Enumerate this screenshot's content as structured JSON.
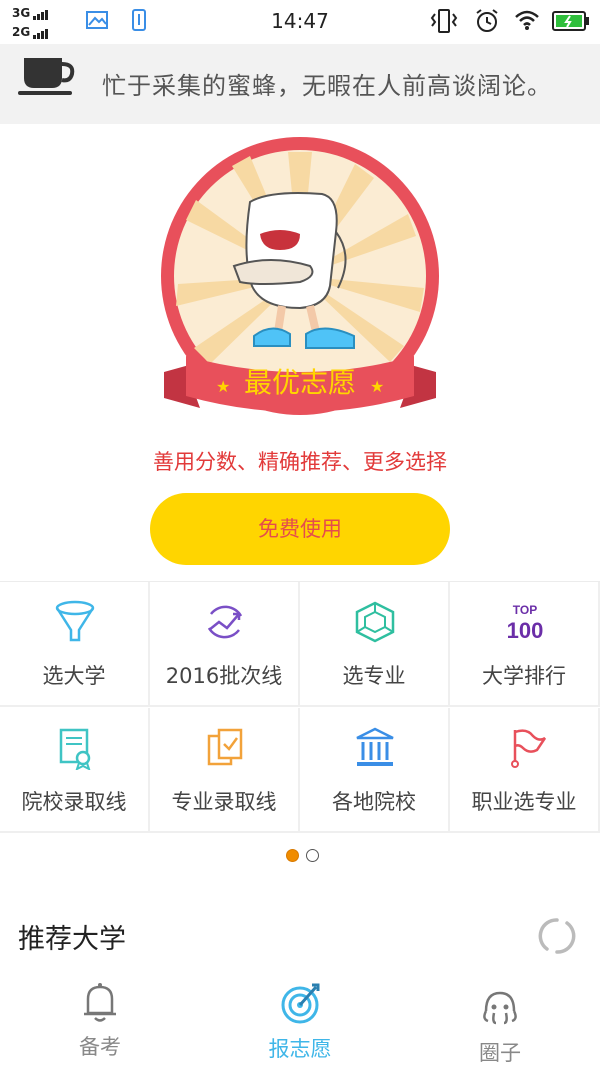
{
  "status_bar": {
    "sig1": "3G",
    "sig2": "2G",
    "time": "14:47"
  },
  "quote": {
    "text": "忙于采集的蜜蜂，无暇在人前高谈阔论。",
    "icon": "coffee-cup-icon"
  },
  "hero": {
    "banner_text": "最优志愿",
    "slogan": "善用分数、精确推荐、更多选择",
    "cta_label": "免费使用",
    "colors": {
      "ring": "#e8505b",
      "cta": "#ffd500",
      "cta_text": "#e54c4c",
      "slogan": "#e23a3a"
    }
  },
  "grid": {
    "items": [
      {
        "label": "选大学",
        "icon": "funnel-icon"
      },
      {
        "label": "2016批次线",
        "icon": "trend-arrow-icon"
      },
      {
        "label": "选专业",
        "icon": "cube-icon"
      },
      {
        "label": "大学排行",
        "icon": "top100-icon",
        "icon_text_top": "TOP",
        "icon_text_num": "100"
      },
      {
        "label": "院校录取线",
        "icon": "certificate-icon"
      },
      {
        "label": "专业录取线",
        "icon": "documents-icon"
      },
      {
        "label": "各地院校",
        "icon": "building-icon"
      },
      {
        "label": "职业选专业",
        "icon": "flag-icon"
      }
    ]
  },
  "pager": {
    "count": 2,
    "active": 1,
    "active_color": "#f08c00"
  },
  "recommend": {
    "title": "推荐大学"
  },
  "tabbar": {
    "tabs": [
      {
        "label": "备考",
        "icon": "bell-icon",
        "active": false
      },
      {
        "label": "报志愿",
        "icon": "target-icon",
        "active": true
      },
      {
        "label": "圈子",
        "icon": "octopus-icon",
        "active": false
      }
    ],
    "active_color": "#3fb6e8",
    "inactive_color": "#888888"
  }
}
